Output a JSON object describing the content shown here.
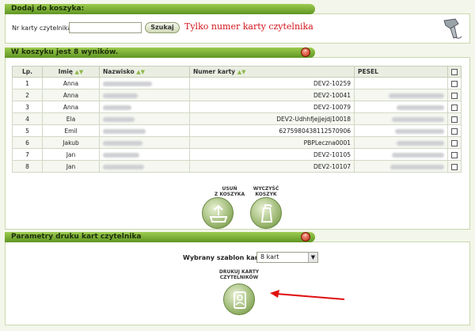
{
  "add_panel": {
    "title": "Dodaj do koszyka:",
    "card_label": "Nr karty czytelnika",
    "card_value": "",
    "search_label": "Szukaj",
    "hint": "Tylko numer karty czytelnika",
    "scanner_icon": "barcode-scanner-icon"
  },
  "cart_panel": {
    "title": "W koszyku jest 8 wyników.",
    "collapse_icon": "collapse-up-icon",
    "columns": [
      "Lp.",
      "Imię",
      "Nazwisko",
      "Numer karty",
      "PESEL"
    ],
    "rows": [
      {
        "lp": "1",
        "imie": "Anna",
        "karta": "DEV2-10259"
      },
      {
        "lp": "2",
        "imie": "Anna",
        "karta": "DEV2-10041"
      },
      {
        "lp": "3",
        "imie": "Anna",
        "karta": "DEV2-10079"
      },
      {
        "lp": "4",
        "imie": "Ela",
        "karta": "DEV2-Udhhfjejjejdj10018"
      },
      {
        "lp": "5",
        "imie": "Emil",
        "karta": "6275980438112570906"
      },
      {
        "lp": "6",
        "imie": "Jakub",
        "karta": "PBPLeczna0001"
      },
      {
        "lp": "7",
        "imie": "Jan",
        "karta": "DEV2-10105"
      },
      {
        "lp": "8",
        "imie": "Jan",
        "karta": "DEV2-10107"
      }
    ],
    "remove_label_1": "USUŃ",
    "remove_label_2": "Z KOSZYKA",
    "clear_label_1": "WYCZYŚĆ",
    "clear_label_2": "KOSZYK"
  },
  "print_panel": {
    "title": "Parametry druku kart czytelnika",
    "template_label": "Wybrany szablon kart",
    "template_value": "8 kart",
    "print_label_1": "DRUKUJ KARTY",
    "print_label_2": "CZYTELNIKÓW"
  },
  "colors": {
    "accent": "#7fb23a",
    "hint": "#d3141b",
    "arrow": "#e01010"
  }
}
